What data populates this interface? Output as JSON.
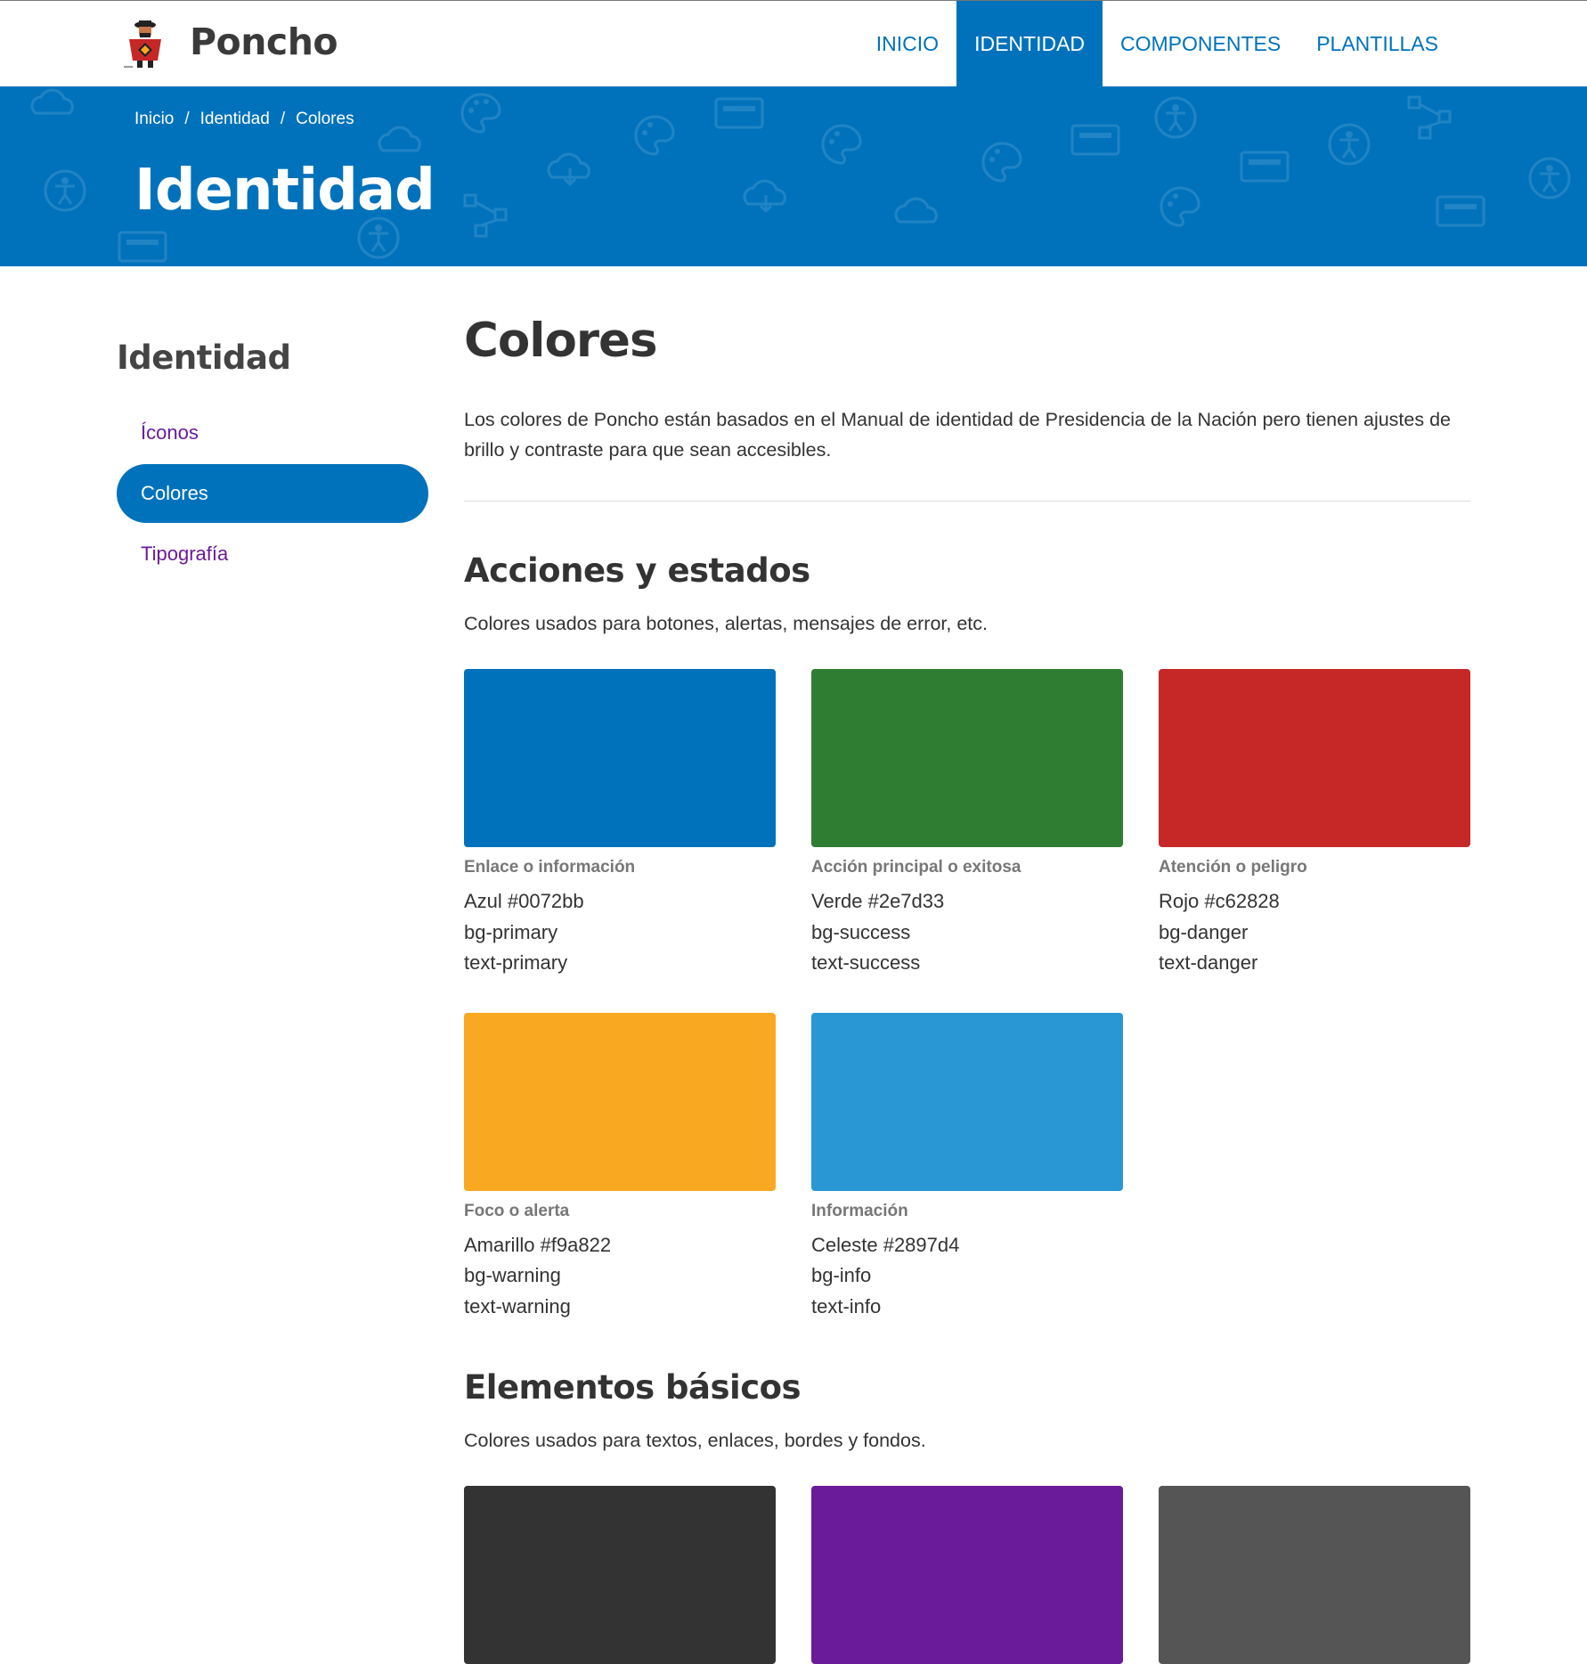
{
  "header": {
    "brand": "Poncho",
    "nav": [
      {
        "label": "INICIO",
        "active": false
      },
      {
        "label": "IDENTIDAD",
        "active": true
      },
      {
        "label": "COMPONENTES",
        "active": false
      },
      {
        "label": "PLANTILLAS",
        "active": false
      }
    ]
  },
  "hero": {
    "breadcrumb": [
      "Inicio",
      "Identidad",
      "Colores"
    ],
    "title": "Identidad"
  },
  "sidebar": {
    "title": "Identidad",
    "items": [
      {
        "label": "Íconos",
        "active": false
      },
      {
        "label": "Colores",
        "active": true
      },
      {
        "label": "Tipografía",
        "active": false
      }
    ]
  },
  "main": {
    "title": "Colores",
    "lead": "Los colores de Poncho están basados en el Manual de identidad de Presidencia de la Nación pero tienen ajustes de brillo y contraste para que sean accesibles.",
    "sections": [
      {
        "title": "Acciones y estados",
        "subtitle": "Colores usados para botones, alertas, mensajes de error, etc.",
        "swatches": [
          {
            "color": "#0072bb",
            "label": "Enlace o información",
            "name": "Azul #0072bb",
            "bg": "bg-primary",
            "text": "text-primary"
          },
          {
            "color": "#2e7d33",
            "label": "Acción principal o exitosa",
            "name": "Verde #2e7d33",
            "bg": "bg-success",
            "text": "text-success"
          },
          {
            "color": "#c62828",
            "label": "Atención o peligro",
            "name": "Rojo #c62828",
            "bg": "bg-danger",
            "text": "text-danger"
          },
          {
            "color": "#f9a822",
            "label": "Foco o alerta",
            "name": "Amarillo #f9a822",
            "bg": "bg-warning",
            "text": "text-warning"
          },
          {
            "color": "#2897d4",
            "label": "Información",
            "name": "Celeste #2897d4",
            "bg": "bg-info",
            "text": "text-info"
          }
        ]
      },
      {
        "title": "Elementos básicos",
        "subtitle": "Colores usados para textos, enlaces, bordes y fondos.",
        "swatches": [
          {
            "color": "#333333"
          },
          {
            "color": "#6a1b99"
          },
          {
            "color": "#555555"
          }
        ]
      }
    ]
  },
  "colors": {
    "primary": "#0072bb",
    "visited_link": "#6a1b9a"
  }
}
